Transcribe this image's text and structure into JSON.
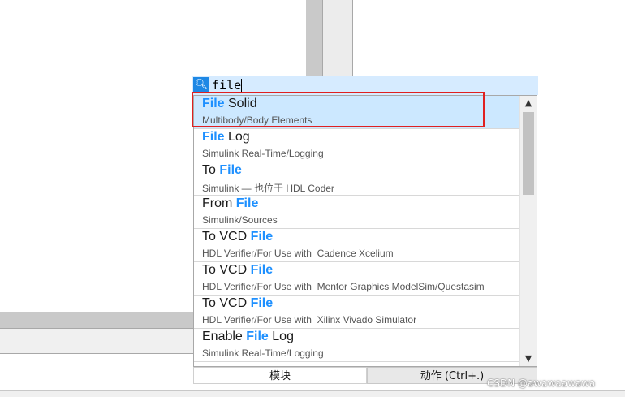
{
  "search": {
    "value": "file",
    "icon": "search-icon"
  },
  "results": [
    {
      "prefix": "",
      "match": "File",
      "suffix": " Solid",
      "subtitle": "Multibody/Body Elements",
      "selected": true
    },
    {
      "prefix": "",
      "match": "File",
      "suffix": " Log",
      "subtitle": "Simulink Real-Time/Logging",
      "selected": false
    },
    {
      "prefix": "To ",
      "match": "File",
      "suffix": "",
      "subtitle": "Simulink — 也位于 HDL Coder",
      "selected": false
    },
    {
      "prefix": "From ",
      "match": "File",
      "suffix": "",
      "subtitle": "Simulink/Sources",
      "selected": false
    },
    {
      "prefix": "To VCD ",
      "match": "File",
      "suffix": "",
      "subtitle": "HDL Verifier/For Use with  Cadence Xcelium",
      "selected": false
    },
    {
      "prefix": "To VCD ",
      "match": "File",
      "suffix": "",
      "subtitle": "HDL Verifier/For Use with  Mentor Graphics ModelSim/Questasim",
      "selected": false
    },
    {
      "prefix": "To VCD ",
      "match": "File",
      "suffix": "",
      "subtitle": "HDL Verifier/For Use with  Xilinx Vivado Simulator",
      "selected": false
    },
    {
      "prefix": "Enable ",
      "match": "File",
      "suffix": " Log",
      "subtitle": "Simulink Real-Time/Logging",
      "selected": false
    }
  ],
  "tabs": {
    "blocks": "模块",
    "actions": "动作 (Ctrl+.)"
  },
  "watermark": "CSDN @awawaawawa",
  "colors": {
    "selected_bg": "#cce8ff",
    "match_text": "#1e90ff",
    "search_bar": "#d6ebff",
    "highlight_border": "#e02020"
  }
}
